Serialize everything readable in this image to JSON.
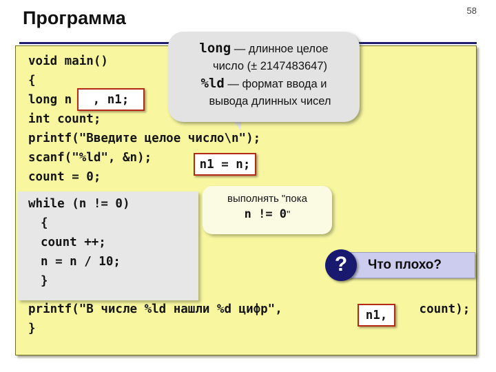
{
  "slide": {
    "number": "58",
    "title": "Программа"
  },
  "code": {
    "lines": [
      "void main()",
      "{",
      "long n",
      "int count;",
      "printf(\"Введите целое число\\n\");",
      "scanf(\"%ld\", &n);",
      "count = 0;"
    ],
    "while_block": [
      "while (n != 0)",
      "{",
      "count ++;",
      "n = n / 10;",
      "}"
    ],
    "tail_lines": [
      "printf(\"В числе %ld нашли %d цифр\",",
      "}"
    ],
    "tail_after_highlight": " count);"
  },
  "highlights": {
    "decl": ", n1;",
    "assign": "n1 = n;",
    "arg": "n1,"
  },
  "callout_long": {
    "line1_mono": "long",
    "line1_text": " — длинное целое",
    "line2_text": "число (± 2147483647)",
    "line3_mono": "%ld",
    "line3_text": " — формат ввода и",
    "line4_text": "вывода длинных чисел"
  },
  "callout_while": {
    "line1": "выполнять \"пока",
    "line2_mono": "n != 0",
    "line2_suffix": "\""
  },
  "question": {
    "glyph": "?",
    "label": "Что плохо?"
  },
  "colors": {
    "panel_bg": "#f8f7a0",
    "panel_border": "#6e6d1c",
    "rule": "#1f1f6e",
    "while_bg": "#e7e7e7",
    "callout_bg": "#e3e3e3",
    "callout2_bg": "#fbfbe4",
    "highlight_border": "#b52a16",
    "badge_bg": "#ccccee",
    "badge_circle": "#191970"
  }
}
